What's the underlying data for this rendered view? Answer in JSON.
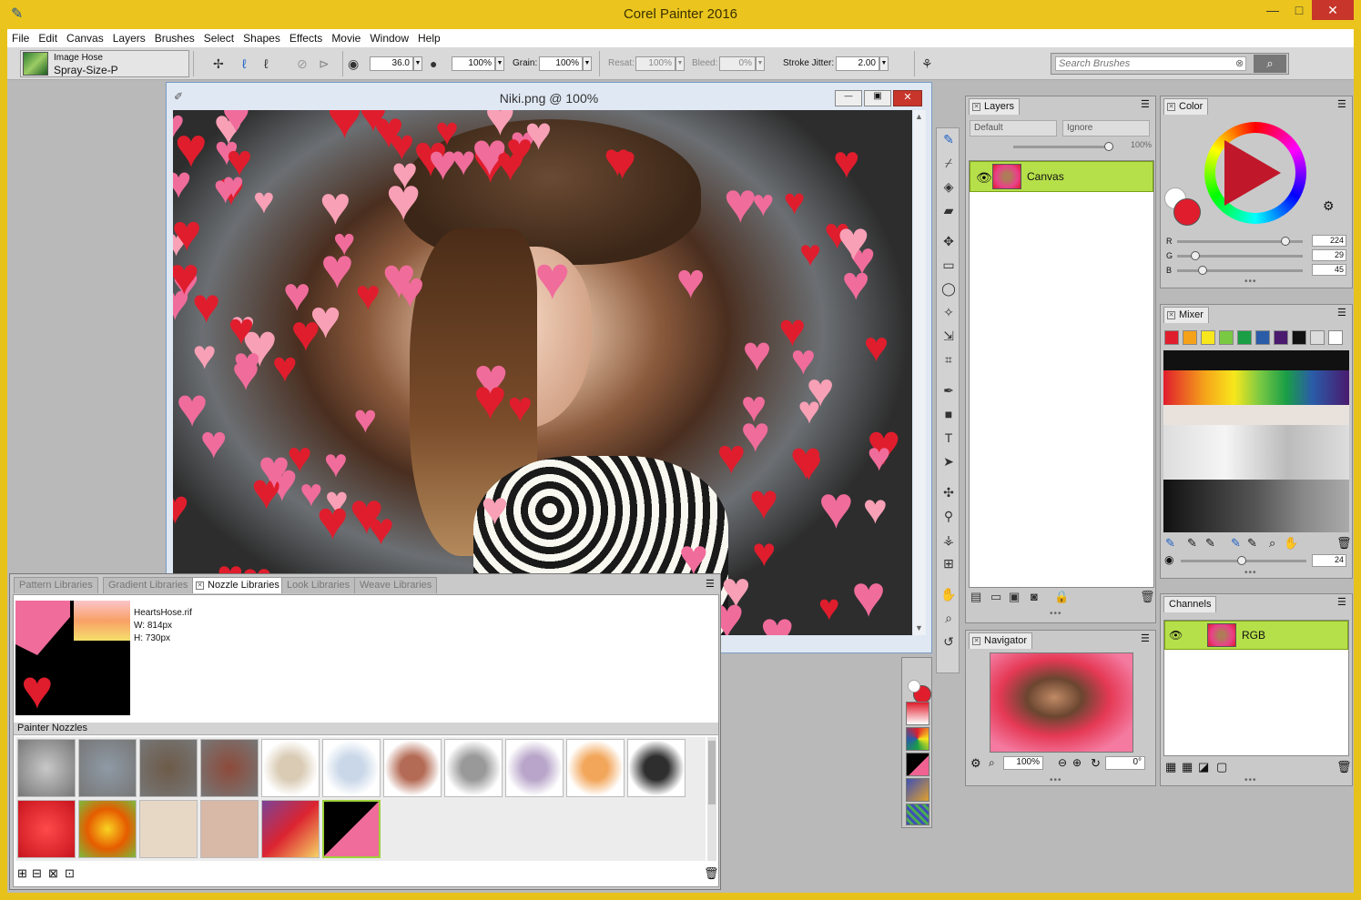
{
  "window": {
    "title": "Corel Painter 2016",
    "minimize": "—",
    "maximize": "□",
    "close": "✕"
  },
  "menu": [
    "File",
    "Edit",
    "Canvas",
    "Layers",
    "Brushes",
    "Select",
    "Shapes",
    "Effects",
    "Movie",
    "Window",
    "Help"
  ],
  "brush": {
    "category": "Image Hose",
    "variant": "Spray-Size-P"
  },
  "props": {
    "size": "36.0",
    "opacity": "100%",
    "grain_label": "Grain:",
    "grain": "100%",
    "resat_label": "Resat:",
    "resat": "100%",
    "bleed_label": "Bleed:",
    "bleed": "0%",
    "jitter_label": "Stroke Jitter:",
    "jitter": "2.00"
  },
  "search": {
    "placeholder": "Search Brushes"
  },
  "document": {
    "title": "Niki.png @ 100%"
  },
  "layers": {
    "tab": "Layers",
    "composite_method": "Default",
    "composite_depth": "Ignore",
    "opacity": "100%",
    "canvas_layer": "Canvas"
  },
  "navigator": {
    "tab": "Navigator",
    "zoom": "100%",
    "rotation": "0°"
  },
  "color": {
    "tab": "Color",
    "r_label": "R",
    "g_label": "G",
    "b_label": "B",
    "r": "224",
    "g": "29",
    "b": "45",
    "r_frac": 0.878,
    "g_frac": 0.114,
    "b_frac": 0.176,
    "main": "#e01d2d"
  },
  "mixer": {
    "tab": "Mixer",
    "brush_size": "24",
    "swatches": [
      "#e01d2d",
      "#f5a21a",
      "#f8e71c",
      "#7ac943",
      "#1a9e46",
      "#2a5ca8",
      "#4a1a6e",
      "#111111",
      "#dcdcdc",
      "#ffffff"
    ]
  },
  "channels": {
    "tab": "Channels",
    "rgb": "RGB"
  },
  "libraries": {
    "tabs": [
      "Pattern Libraries",
      "Gradient Libraries",
      "Nozzle Libraries",
      "Look Libraries",
      "Weave Libraries"
    ],
    "active": 2,
    "nozzle_name": "HeartsHose.rif",
    "width": "W: 814px",
    "height": "H: 730px",
    "section": "Painter Nozzles"
  },
  "icons": {
    "brush": "brush-icon",
    "dropper": "dropper-icon",
    "paint_bucket": "paint-bucket-icon",
    "eraser": "eraser-icon",
    "transform": "transform-icon",
    "rect_select": "rect-select-icon",
    "lasso": "lasso-icon",
    "magic_wand": "magic-wand-icon",
    "selection_adjuster": "selection-adjuster-icon",
    "crop": "crop-icon",
    "pen": "pen-icon",
    "rectangle": "rectangle-icon",
    "text": "text-icon",
    "shape_selection": "shape-selection-icon",
    "cloner": "cloner-icon",
    "rubber_stamp": "rubber-stamp-icon",
    "blend": "blend-icon",
    "divine_proportion": "divine-proportion-icon",
    "grabber": "grabber-icon",
    "magnifier": "magnifier-icon",
    "rotate_page": "rotate-page-icon"
  }
}
